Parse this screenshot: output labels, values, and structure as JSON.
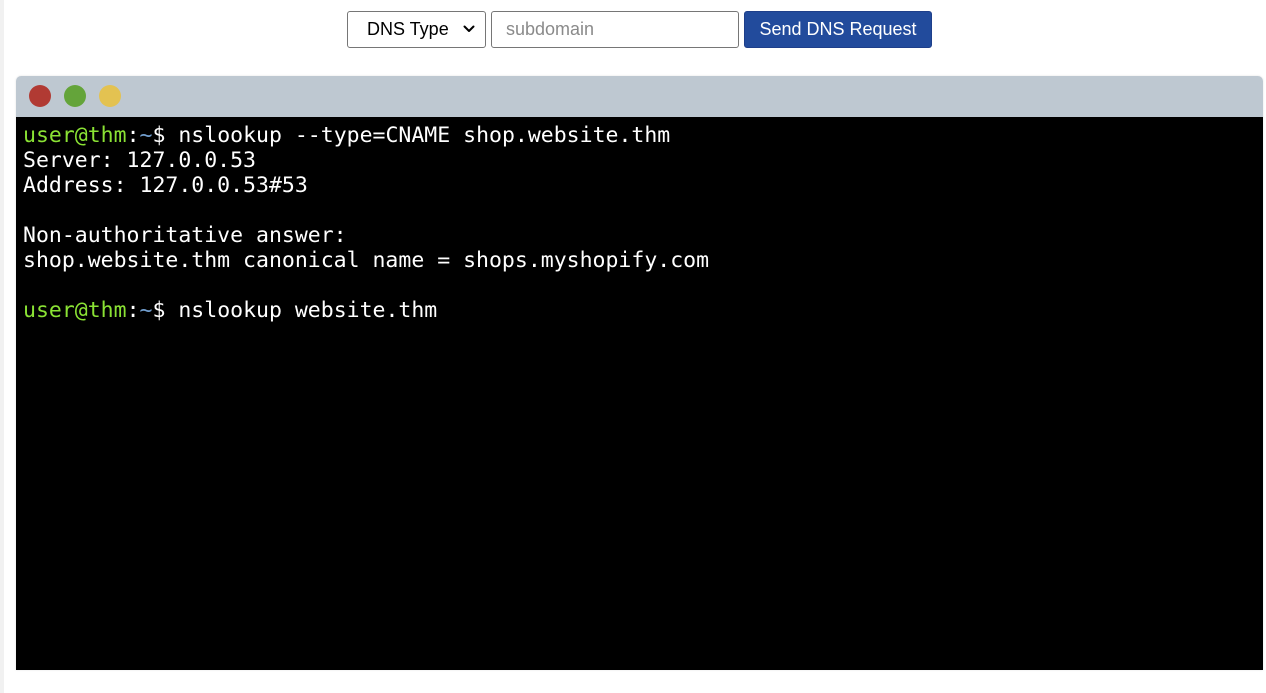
{
  "controls": {
    "dns_type": {
      "selected": "DNS Type"
    },
    "subdomain": {
      "placeholder": "subdomain",
      "value": ""
    },
    "send_label": "Send DNS Request"
  },
  "terminal": {
    "window_buttons": {
      "close_color": "#b13a33",
      "maximize_color": "#64a43a",
      "minimize_color": "#e3c251"
    },
    "prompt": {
      "user_host": "user@thm",
      "colon": ":",
      "path": "~",
      "symbol": "$ "
    },
    "lines": [
      {
        "type": "command",
        "text": "nslookup --type=CNAME shop.website.thm"
      },
      {
        "type": "output",
        "text": "Server: 127.0.0.53"
      },
      {
        "type": "output",
        "text": "Address: 127.0.0.53#53"
      },
      {
        "type": "blank",
        "text": ""
      },
      {
        "type": "output",
        "text": "Non-authoritative answer:"
      },
      {
        "type": "output",
        "text": "shop.website.thm canonical name = shops.myshopify.com"
      },
      {
        "type": "blank",
        "text": ""
      },
      {
        "type": "command",
        "text": "nslookup website.thm"
      }
    ]
  }
}
